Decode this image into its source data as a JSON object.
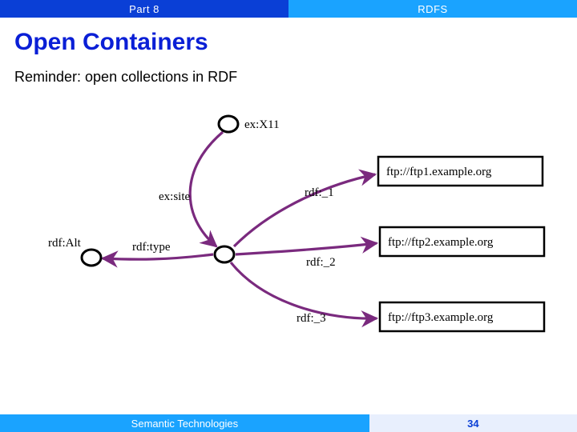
{
  "header": {
    "left": "Part 8",
    "right": "RDFS"
  },
  "title": "Open Containers",
  "subtitle": "Reminder: open collections in RDF",
  "nodes": {
    "top": {
      "kind": "bnode",
      "label": "ex:X11"
    },
    "left": {
      "kind": "bnode",
      "label": "rdf:Alt"
    },
    "center": {
      "kind": "bnode",
      "label": ""
    },
    "lit1": {
      "kind": "literal",
      "label": "ftp://ftp1.example.org"
    },
    "lit2": {
      "kind": "literal",
      "label": "ftp://ftp2.example.org"
    },
    "lit3": {
      "kind": "literal",
      "label": "ftp://ftp3.example.org"
    }
  },
  "edges": {
    "site": "ex:site",
    "type": "rdf:type",
    "m1": "rdf:_1",
    "m2": "rdf:_2",
    "m3": "rdf:_3"
  },
  "footer": {
    "left": "Semantic Technologies",
    "right": "34"
  }
}
